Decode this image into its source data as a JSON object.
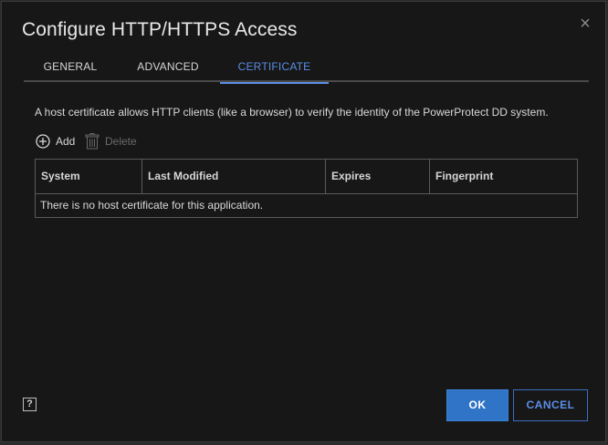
{
  "dialog": {
    "title": "Configure HTTP/HTTPS Access",
    "close_glyph": "×"
  },
  "tabs": [
    {
      "label": "GENERAL",
      "active": false
    },
    {
      "label": "ADVANCED",
      "active": false
    },
    {
      "label": "CERTIFICATE",
      "active": true
    }
  ],
  "certificate": {
    "description": "A host certificate allows HTTP clients (like a browser) to verify the identity of the PowerProtect DD system.",
    "add_label": "Add",
    "delete_label": "Delete",
    "columns": [
      "System",
      "Last Modified",
      "Expires",
      "Fingerprint"
    ],
    "empty_message": "There is no host certificate for this application."
  },
  "footer": {
    "help_label": "?",
    "ok_label": "OK",
    "cancel_label": "CANCEL"
  },
  "colors": {
    "accent": "#5b8ee6",
    "primary_button": "#2f74c7",
    "background": "#171717"
  }
}
